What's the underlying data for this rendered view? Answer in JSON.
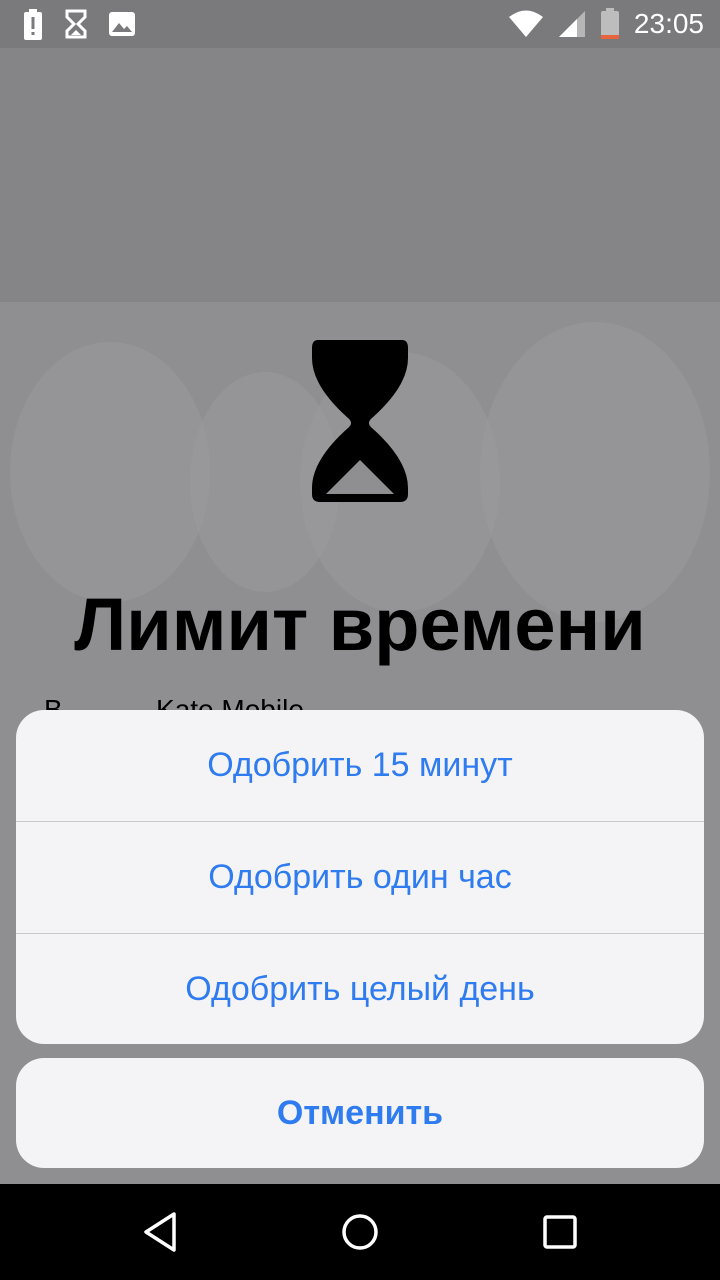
{
  "status_bar": {
    "time": "23:05",
    "left_icons": [
      "battery-alert-icon",
      "hourglass-icon",
      "image-icon"
    ],
    "right_icons": [
      "wifi-icon",
      "signal-icon",
      "battery-low-icon"
    ]
  },
  "screen": {
    "title": "Лимит времени",
    "subtitle": "В... ... ... Kate Mobile"
  },
  "action_sheet": {
    "options": [
      {
        "label": "Одобрить 15 минут"
      },
      {
        "label": "Одобрить один час"
      },
      {
        "label": "Одобрить целый день"
      }
    ],
    "cancel_label": "Отменить"
  },
  "colors": {
    "accent": "#2f7bf0",
    "sheet_bg": "#f4f4f6",
    "scrim": "#8a8a8c"
  },
  "nav_bar": {
    "buttons": [
      "back-icon",
      "home-icon",
      "recents-icon"
    ]
  }
}
